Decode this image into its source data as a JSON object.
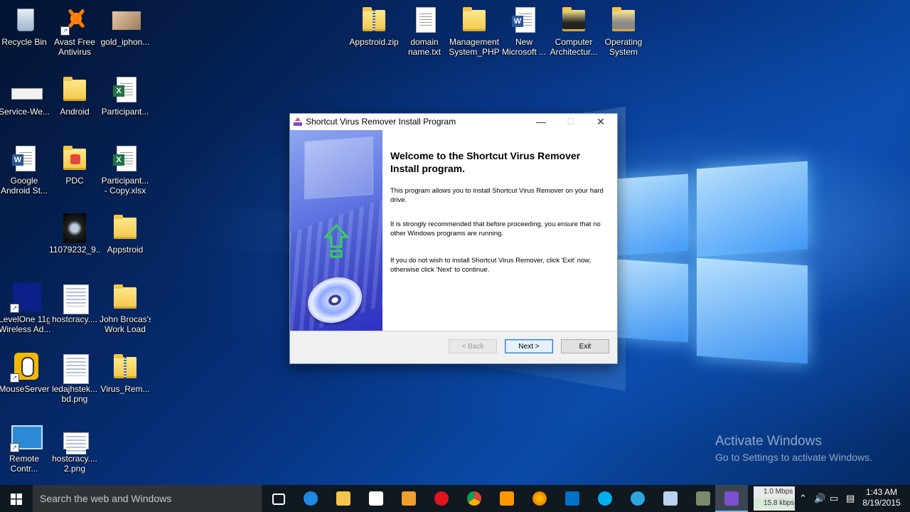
{
  "desktop": {
    "icons": [
      {
        "label1": "Recycle Bin",
        "label2": ""
      },
      {
        "label1": "Avast Free",
        "label2": "Antivirus"
      },
      {
        "label1": "gold_iphon...",
        "label2": ""
      },
      {
        "label1": "Service-We...",
        "label2": ""
      },
      {
        "label1": "Android",
        "label2": ""
      },
      {
        "label1": "Participant...",
        "label2": ""
      },
      {
        "label1": "Google",
        "label2": "Android St..."
      },
      {
        "label1": "PDC",
        "label2": ""
      },
      {
        "label1": "Participant...",
        "label2": "- Copy.xlsx"
      },
      {
        "label1": "11079232_9...",
        "label2": ""
      },
      {
        "label1": "Appstroid",
        "label2": ""
      },
      {
        "label1": "LevelOne 11g",
        "label2": "Wireless Ad..."
      },
      {
        "label1": "hostcracy....",
        "label2": ""
      },
      {
        "label1": "John Brocas's",
        "label2": "Work Load"
      },
      {
        "label1": "MouseServer",
        "label2": ""
      },
      {
        "label1": "ledajhstek...",
        "label2": "bd.png"
      },
      {
        "label1": "Virus_Rem...",
        "label2": ""
      },
      {
        "label1": "Remote",
        "label2": "Contr..."
      },
      {
        "label1": "hostcracy....",
        "label2": "2.png"
      },
      {
        "label1": "Appstroid.zip",
        "label2": ""
      },
      {
        "label1": "domain",
        "label2": "name.txt"
      },
      {
        "label1": "Management",
        "label2": "System_PHP"
      },
      {
        "label1": "New",
        "label2": "Microsoft ..."
      },
      {
        "label1": "Computer",
        "label2": "Architectur..."
      },
      {
        "label1": "Operating",
        "label2": "System"
      }
    ]
  },
  "dialog": {
    "title": "Shortcut Virus Remover Install Program",
    "minimize": "—",
    "maximize": "☐",
    "close": "✕",
    "heading": "Welcome to the Shortcut Virus Remover Install program.",
    "paragraphs": [
      "This program allows you to install Shortcut Virus Remover on your hard drive.",
      "It is strongly recommended that before proceeding, you ensure that no other Windows programs are running.",
      "If you do not wish to install Shortcut Virus Remover, click 'Exit' now, otherwise click 'Next' to continue."
    ],
    "buttons": {
      "back": "< Back",
      "next": "Next >",
      "exit": "Exit"
    }
  },
  "watermark": {
    "line1": "Activate Windows",
    "line2": "Go to Settings to activate Windows."
  },
  "taskbar": {
    "search_placeholder": "Search the web and Windows",
    "net_down": "1.0 Mbps",
    "net_up": "15.8 kbps",
    "time": "1:43 AM",
    "date": "8/19/2015",
    "icons": [
      "task-view",
      "edge",
      "file-explorer",
      "store",
      "media-player",
      "opera",
      "chrome",
      "sublime",
      "firefox",
      "outlook",
      "skype",
      "telegram",
      "notepad",
      "app-install",
      "installer-active"
    ]
  },
  "colors": {
    "accent": "#2f7ad1",
    "taskbar": "#101820",
    "dialog_side": "#2d2fc0"
  }
}
